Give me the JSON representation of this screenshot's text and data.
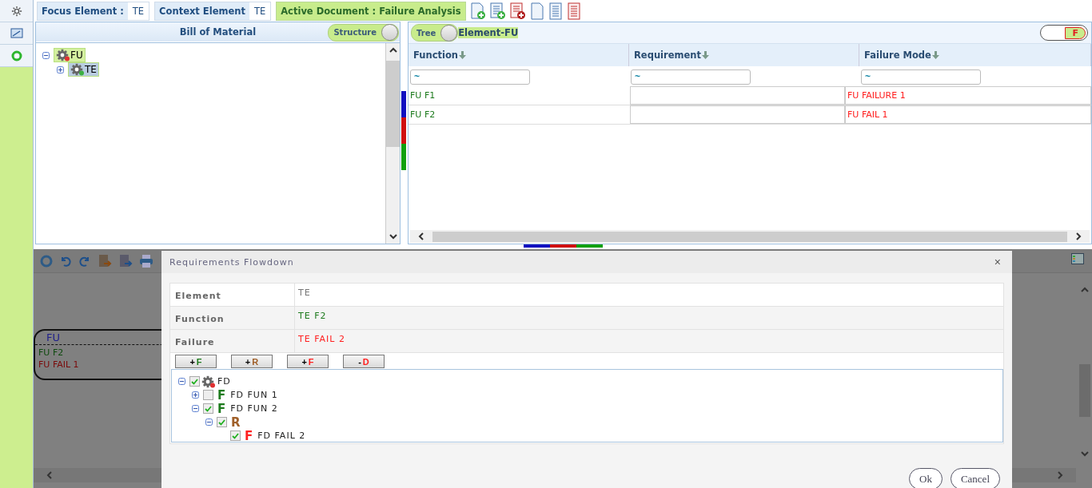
{
  "header": {
    "focus_element": {
      "label": "Focus Element :",
      "value": "TE"
    },
    "context_element": {
      "label": "Context Element",
      "value": "TE"
    },
    "active_document": "Active Document : Failure Analysis"
  },
  "bom_panel": {
    "title": "Bill of Material",
    "structure_toggle": {
      "label": "Structure",
      "on": true
    },
    "tree": [
      {
        "label": "FU",
        "expanded": true,
        "selected": false,
        "color": "#e03030",
        "children": [
          {
            "label": "TE",
            "expanded": false,
            "selected": true,
            "color": "#3cb043"
          }
        ]
      }
    ]
  },
  "fm_panel": {
    "tree_toggle": {
      "label": "Tree",
      "on": true
    },
    "element_label": "Element-FU",
    "f_toggle": {
      "label": "F",
      "on": true
    },
    "columns": [
      {
        "label": "Function"
      },
      {
        "label": "Requirement"
      },
      {
        "label": "Failure Mode"
      }
    ],
    "filters": [
      "~",
      "~",
      "~"
    ],
    "rows": [
      {
        "function": "FU F1",
        "failure_mode": "FU FAILURE 1"
      },
      {
        "function": "FU F2",
        "failure_mode": "FU FAIL 1"
      }
    ]
  },
  "diagram": {
    "node": {
      "title": "FU",
      "function": "FU F2",
      "failure": "FU FAIL 1"
    }
  },
  "dialog": {
    "title": "Requirements Flowdown",
    "close": "×",
    "fields": [
      {
        "label": "Element",
        "value": "TE",
        "kind": "element"
      },
      {
        "label": "Function",
        "value": "TE F2",
        "kind": "function"
      },
      {
        "label": "Failure",
        "value": "TE FAIL 2",
        "kind": "failure"
      }
    ],
    "actions": [
      {
        "sign": "+",
        "letter": "F",
        "kind": "function"
      },
      {
        "sign": "+",
        "letter": "R",
        "kind": "requirement"
      },
      {
        "sign": "+",
        "letter": "F",
        "kind": "failure"
      },
      {
        "sign": "-",
        "letter": "D",
        "kind": "delete"
      }
    ],
    "tree": [
      {
        "kind": "element",
        "label": "FD",
        "checked": true,
        "expanded": true,
        "children": [
          {
            "kind": "function",
            "badge": "F",
            "label": "FD FUN 1",
            "checked": false,
            "expanded": false
          },
          {
            "kind": "function",
            "badge": "F",
            "label": "FD FUN 2",
            "checked": true,
            "expanded": true,
            "children": [
              {
                "kind": "requirement",
                "badge": "R",
                "checked": true,
                "expanded": true,
                "children": [
                  {
                    "kind": "failure",
                    "badge": "F",
                    "label": "FD FAIL 2",
                    "checked": true
                  }
                ]
              }
            ]
          }
        ]
      }
    ],
    "buttons": [
      "Ok",
      "Cancel"
    ]
  }
}
